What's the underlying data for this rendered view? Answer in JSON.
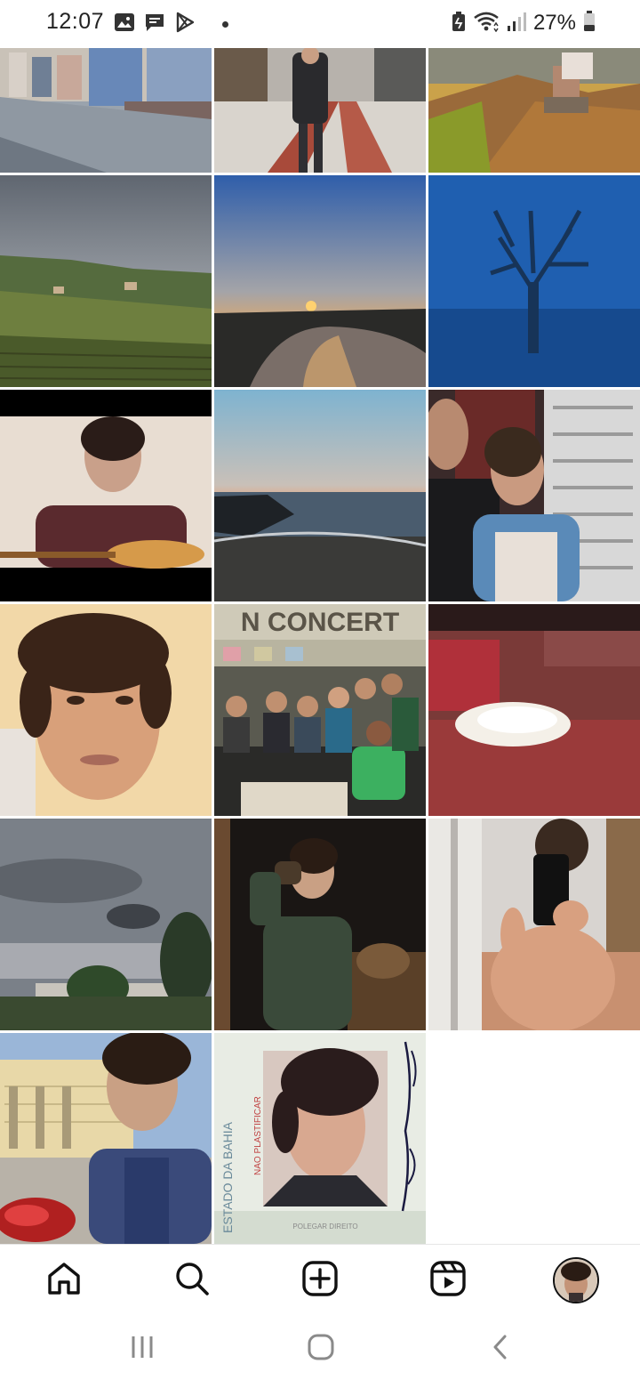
{
  "status_bar": {
    "time": "12:07",
    "battery_percent": "27%",
    "notification_icons": [
      "gallery-icon",
      "message-icon",
      "play-store-icon",
      "more-dot"
    ],
    "system_icons": [
      "battery-saver-icon",
      "wifi-icon",
      "signal-icon",
      "battery-icon"
    ]
  },
  "photo_grid": {
    "tiles": [
      {
        "subject": "street with striped houses and cobblestone"
      },
      {
        "subject": "person standing on patterned sidewalk"
      },
      {
        "subject": "person sitting on rock at sunset"
      },
      {
        "subject": "green vineyard hills under cloudy sky"
      },
      {
        "subject": "river sunset"
      },
      {
        "subject": "bare tree in blue fog"
      },
      {
        "subject": "young man playing guitar"
      },
      {
        "subject": "beach sunset"
      },
      {
        "subject": "two people smiling indoors"
      },
      {
        "subject": "selfie of curly-haired young man"
      },
      {
        "subject": "group photo under concert sign",
        "sign_text": "N CONCERT"
      },
      {
        "subject": "white cat on red sofa"
      },
      {
        "subject": "cloudy sky over trees"
      },
      {
        "subject": "man drinking from cup in dark room"
      },
      {
        "subject": "mirror selfie"
      },
      {
        "subject": "man in front of historic building with red flowers"
      },
      {
        "subject": "old ID card photo",
        "card_text": "ESTADO DA BAHIA",
        "card_text_2": "POLEGAR DIREITO",
        "card_stamp": "NAO PLASTIFICAR"
      }
    ]
  },
  "bottom_nav": {
    "items": [
      "home-icon",
      "search-icon",
      "create-post-icon",
      "reels-icon",
      "profile-avatar"
    ],
    "active": "profile-avatar"
  },
  "system_nav": {
    "items": [
      "recent-apps-icon",
      "home-circle-icon",
      "back-icon"
    ]
  },
  "colors": {
    "background": "#ffffff",
    "icon_dark": "#111111",
    "system_icon": "#8a8a8a"
  }
}
